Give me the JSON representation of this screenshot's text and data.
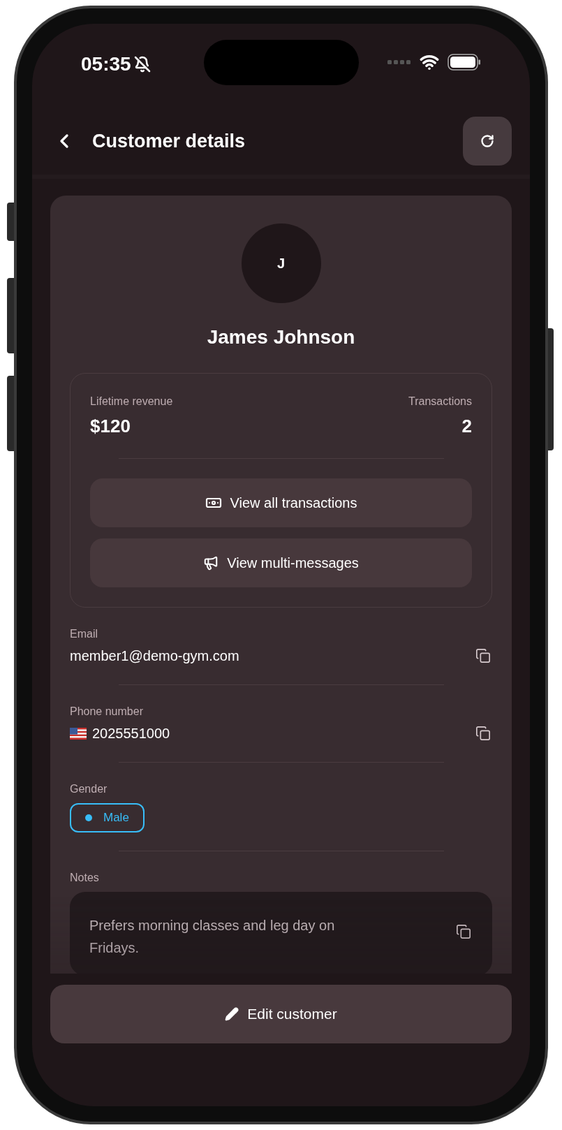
{
  "status_bar": {
    "time": "05:35"
  },
  "header": {
    "title": "Customer details"
  },
  "customer": {
    "initial": "J",
    "name": "James Johnson"
  },
  "stats": [
    {
      "label": "Lifetime revenue",
      "value": "$120"
    },
    {
      "label": "Transactions",
      "value": "2"
    }
  ],
  "actions": [
    {
      "kind": "money",
      "label": "View all transactions"
    },
    {
      "kind": "megaphone",
      "label": "View multi-messages"
    }
  ],
  "fields": [
    {
      "kind": "text",
      "label": "Email",
      "value": "member1@demo-gym.com"
    },
    {
      "kind": "phone",
      "label": "Phone number",
      "value": "2025551000"
    },
    {
      "kind": "chip",
      "label": "Gender",
      "value": "Male",
      "color": "#38bdf8"
    },
    {
      "kind": "note",
      "label": "Notes",
      "value": "Prefers morning classes and leg day on Fridays."
    }
  ],
  "footer_button": {
    "label": "Edit customer"
  }
}
